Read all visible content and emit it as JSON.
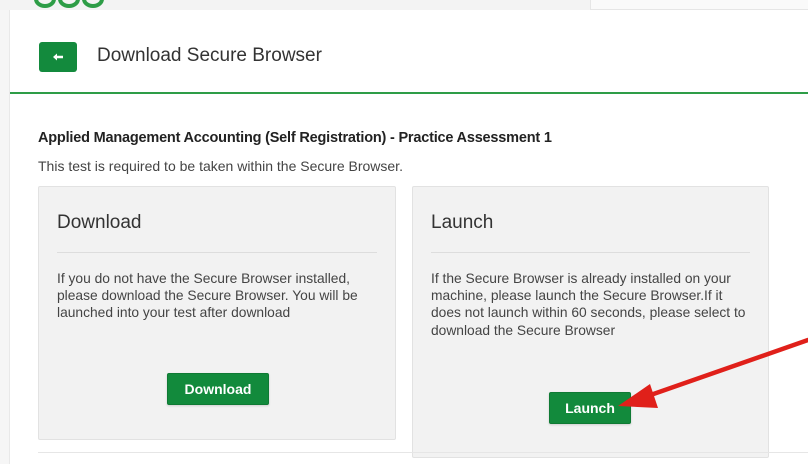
{
  "colors": {
    "brand_green": "#138a3d",
    "header_rule": "#2e9d47",
    "panel_bg": "#f2f2f2",
    "annotation_arrow": "#e0201a"
  },
  "header": {
    "back_icon": "arrow-left-icon",
    "title": "Download Secure Browser"
  },
  "assessment": {
    "title": "Applied Management Accounting (Self Registration) - Practice Assessment 1",
    "info": "This test is required to be taken within the Secure Browser."
  },
  "panels": {
    "download": {
      "title": "Download",
      "text": "If you do not have the Secure Browser installed, please download the Secure Browser. You will be launched into your test after download",
      "button_label": "Download"
    },
    "launch": {
      "title": "Launch",
      "text": "If the Secure Browser is already installed on your machine, please launch the Secure Browser.If it does not launch within 60 seconds, please select to download the Secure Browser",
      "button_label": "Launch"
    }
  },
  "annotation": {
    "icon": "red-arrow-icon"
  }
}
